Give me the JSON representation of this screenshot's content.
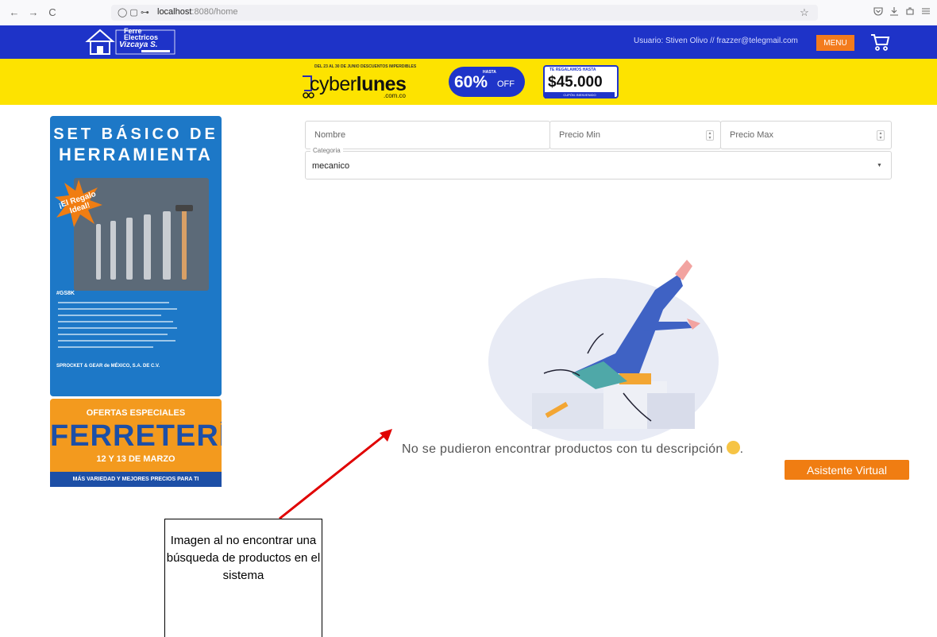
{
  "browser": {
    "back_icon": "←",
    "forward_icon": "→",
    "reload_icon": "C",
    "url_host": "localhost",
    "url_path": ":8080/home",
    "star_icon": "☆"
  },
  "header": {
    "logo_line1": "Ferre",
    "logo_line2": "Electricos",
    "logo_line3": "Vizcaya S.",
    "user_text": "Usuario: Stiven Olivo // frazzer@telegmail.com",
    "menu_label": "MENU",
    "accent_color": "#1e33c8",
    "button_color": "#f37b1d"
  },
  "promo": {
    "small_text": "DEL 23 AL 30 DE JUNIO DESCUENTOS IMPERDIBLES",
    "brand_light": "cyber",
    "brand_bold": "lunes",
    "brand_suffix": ".com.co",
    "discount_top": "HASTA",
    "discount_pct": "60%",
    "discount_off": "OFF",
    "coupon_top": "TE REGALAMOS HASTA",
    "coupon_amount": "$45.000",
    "coupon_tag": "CUPÓN: BIENVENIDO"
  },
  "ads": {
    "tools_line1": "SET BÁSICO DE",
    "tools_line2": "HERRAMIENTA",
    "tools_badge": "¡El Regalo Ideal!",
    "tools_code": "#GS8K",
    "tools_footer": "SPROCKET & GEAR de MÉXICO, S.A. DE C.V.",
    "ferre_top": "OFERTAS ESPECIALES",
    "ferre_main": "FERRETERÍAS",
    "ferre_date": "12 Y 13 DE MARZO",
    "ferre_bottom": "MÁS VARIEDAD Y MEJORES PRECIOS PARA TI"
  },
  "filters": {
    "name_placeholder": "Nombre",
    "price_min_placeholder": "Precio Min",
    "price_max_placeholder": "Precio Max",
    "category_label": "Categoria",
    "category_value": "mecanico"
  },
  "empty_state": {
    "message": "No se pudieron encontrar productos con tu descripción"
  },
  "assistant": {
    "label": "Asistente Virtual"
  },
  "annotation": {
    "text": "Imagen al no encontrar una búsqueda de productos en el sistema"
  }
}
